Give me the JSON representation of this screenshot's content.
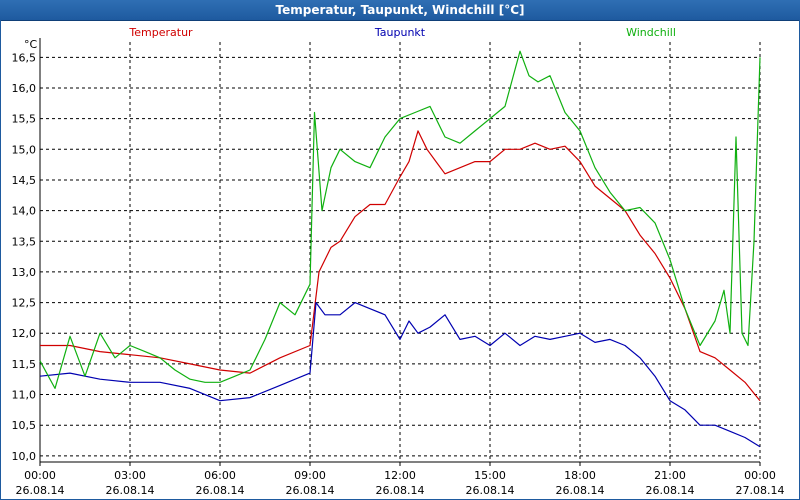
{
  "window": {
    "title": "Temperatur, Taupunkt, Windchill [°C]"
  },
  "chart_data": {
    "type": "line",
    "unit": "°C",
    "ylim": [
      9.9,
      16.75
    ],
    "y_ticks": [
      "10,0",
      "10,5",
      "11,0",
      "11,5",
      "12,0",
      "12,5",
      "13,0",
      "13,5",
      "14,0",
      "14,5",
      "15,0",
      "15,5",
      "16,0",
      "16,5"
    ],
    "y_tick_values": [
      10.0,
      10.5,
      11.0,
      11.5,
      12.0,
      12.5,
      13.0,
      13.5,
      14.0,
      14.5,
      15.0,
      15.5,
      16.0,
      16.5
    ],
    "x_range_hours": [
      0,
      24
    ],
    "x_ticks": [
      {
        "time": "00:00",
        "date": "26.08.14"
      },
      {
        "time": "03:00",
        "date": "26.08.14"
      },
      {
        "time": "06:00",
        "date": "26.08.14"
      },
      {
        "time": "09:00",
        "date": "26.08.14"
      },
      {
        "time": "12:00",
        "date": "26.08.14"
      },
      {
        "time": "15:00",
        "date": "26.08.14"
      },
      {
        "time": "18:00",
        "date": "26.08.14"
      },
      {
        "time": "21:00",
        "date": "26.08.14"
      },
      {
        "time": "00:00",
        "date": "27.08.14"
      }
    ],
    "grid": true,
    "legend_position": "top",
    "series": [
      {
        "name": "Temperatur",
        "color": "#d00000",
        "points": [
          [
            0,
            11.8
          ],
          [
            1,
            11.8
          ],
          [
            2,
            11.7
          ],
          [
            3,
            11.65
          ],
          [
            4,
            11.6
          ],
          [
            5,
            11.5
          ],
          [
            6,
            11.4
          ],
          [
            7,
            11.35
          ],
          [
            8,
            11.6
          ],
          [
            9,
            11.8
          ],
          [
            9.3,
            13.0
          ],
          [
            9.7,
            13.4
          ],
          [
            10,
            13.5
          ],
          [
            10.5,
            13.9
          ],
          [
            11,
            14.1
          ],
          [
            11.5,
            14.1
          ],
          [
            12,
            14.55
          ],
          [
            12.3,
            14.8
          ],
          [
            12.6,
            15.3
          ],
          [
            12.9,
            15.0
          ],
          [
            13.2,
            14.8
          ],
          [
            13.5,
            14.6
          ],
          [
            14,
            14.7
          ],
          [
            14.5,
            14.8
          ],
          [
            15,
            14.8
          ],
          [
            15.5,
            15.0
          ],
          [
            16,
            15.0
          ],
          [
            16.5,
            15.1
          ],
          [
            17,
            15.0
          ],
          [
            17.5,
            15.05
          ],
          [
            18,
            14.8
          ],
          [
            18.5,
            14.4
          ],
          [
            19,
            14.2
          ],
          [
            19.5,
            14.0
          ],
          [
            20,
            13.6
          ],
          [
            20.5,
            13.3
          ],
          [
            21,
            12.9
          ],
          [
            21.5,
            12.4
          ],
          [
            22,
            11.7
          ],
          [
            22.5,
            11.6
          ],
          [
            23,
            11.4
          ],
          [
            23.5,
            11.2
          ],
          [
            24,
            10.9
          ]
        ]
      },
      {
        "name": "Taupunkt",
        "color": "#0000b0",
        "points": [
          [
            0,
            11.3
          ],
          [
            1,
            11.35
          ],
          [
            2,
            11.25
          ],
          [
            3,
            11.2
          ],
          [
            4,
            11.2
          ],
          [
            5,
            11.1
          ],
          [
            6,
            10.9
          ],
          [
            7,
            10.95
          ],
          [
            8,
            11.15
          ],
          [
            9,
            11.35
          ],
          [
            9.2,
            12.5
          ],
          [
            9.5,
            12.3
          ],
          [
            10,
            12.3
          ],
          [
            10.5,
            12.5
          ],
          [
            11,
            12.4
          ],
          [
            11.5,
            12.3
          ],
          [
            12,
            11.9
          ],
          [
            12.3,
            12.2
          ],
          [
            12.6,
            12.0
          ],
          [
            13,
            12.1
          ],
          [
            13.5,
            12.3
          ],
          [
            14,
            11.9
          ],
          [
            14.5,
            11.95
          ],
          [
            15,
            11.8
          ],
          [
            15.5,
            12.0
          ],
          [
            16,
            11.8
          ],
          [
            16.5,
            11.95
          ],
          [
            17,
            11.9
          ],
          [
            17.5,
            11.95
          ],
          [
            18,
            12.0
          ],
          [
            18.5,
            11.85
          ],
          [
            19,
            11.9
          ],
          [
            19.5,
            11.8
          ],
          [
            20,
            11.6
          ],
          [
            20.5,
            11.3
          ],
          [
            21,
            10.9
          ],
          [
            21.5,
            10.75
          ],
          [
            22,
            10.5
          ],
          [
            22.5,
            10.5
          ],
          [
            23,
            10.4
          ],
          [
            23.5,
            10.3
          ],
          [
            24,
            10.15
          ]
        ]
      },
      {
        "name": "Windchill",
        "color": "#10b010",
        "points": [
          [
            0,
            11.55
          ],
          [
            0.5,
            11.1
          ],
          [
            1,
            11.95
          ],
          [
            1.5,
            11.3
          ],
          [
            2,
            12.0
          ],
          [
            2.5,
            11.6
          ],
          [
            3,
            11.8
          ],
          [
            3.5,
            11.7
          ],
          [
            4,
            11.6
          ],
          [
            4.5,
            11.4
          ],
          [
            5,
            11.25
          ],
          [
            5.5,
            11.2
          ],
          [
            6,
            11.2
          ],
          [
            6.5,
            11.3
          ],
          [
            7,
            11.4
          ],
          [
            7.5,
            11.9
          ],
          [
            8,
            12.5
          ],
          [
            8.5,
            12.3
          ],
          [
            9,
            12.8
          ],
          [
            9.15,
            15.6
          ],
          [
            9.4,
            14.0
          ],
          [
            9.7,
            14.7
          ],
          [
            10,
            15.0
          ],
          [
            10.5,
            14.8
          ],
          [
            11,
            14.7
          ],
          [
            11.5,
            15.2
          ],
          [
            12,
            15.5
          ],
          [
            12.5,
            15.6
          ],
          [
            13,
            15.7
          ],
          [
            13.5,
            15.2
          ],
          [
            14,
            15.1
          ],
          [
            14.5,
            15.3
          ],
          [
            15,
            15.5
          ],
          [
            15.5,
            15.7
          ],
          [
            16,
            16.6
          ],
          [
            16.3,
            16.2
          ],
          [
            16.6,
            16.1
          ],
          [
            17,
            16.2
          ],
          [
            17.5,
            15.6
          ],
          [
            18,
            15.3
          ],
          [
            18.5,
            14.7
          ],
          [
            19,
            14.3
          ],
          [
            19.5,
            14.0
          ],
          [
            20,
            14.05
          ],
          [
            20.5,
            13.8
          ],
          [
            21,
            13.2
          ],
          [
            21.5,
            12.4
          ],
          [
            22,
            11.8
          ],
          [
            22.5,
            12.2
          ],
          [
            22.8,
            12.7
          ],
          [
            23,
            12.0
          ],
          [
            23.2,
            15.2
          ],
          [
            23.4,
            12.0
          ],
          [
            23.6,
            11.8
          ],
          [
            23.8,
            13.5
          ],
          [
            24,
            16.5
          ]
        ]
      }
    ]
  }
}
